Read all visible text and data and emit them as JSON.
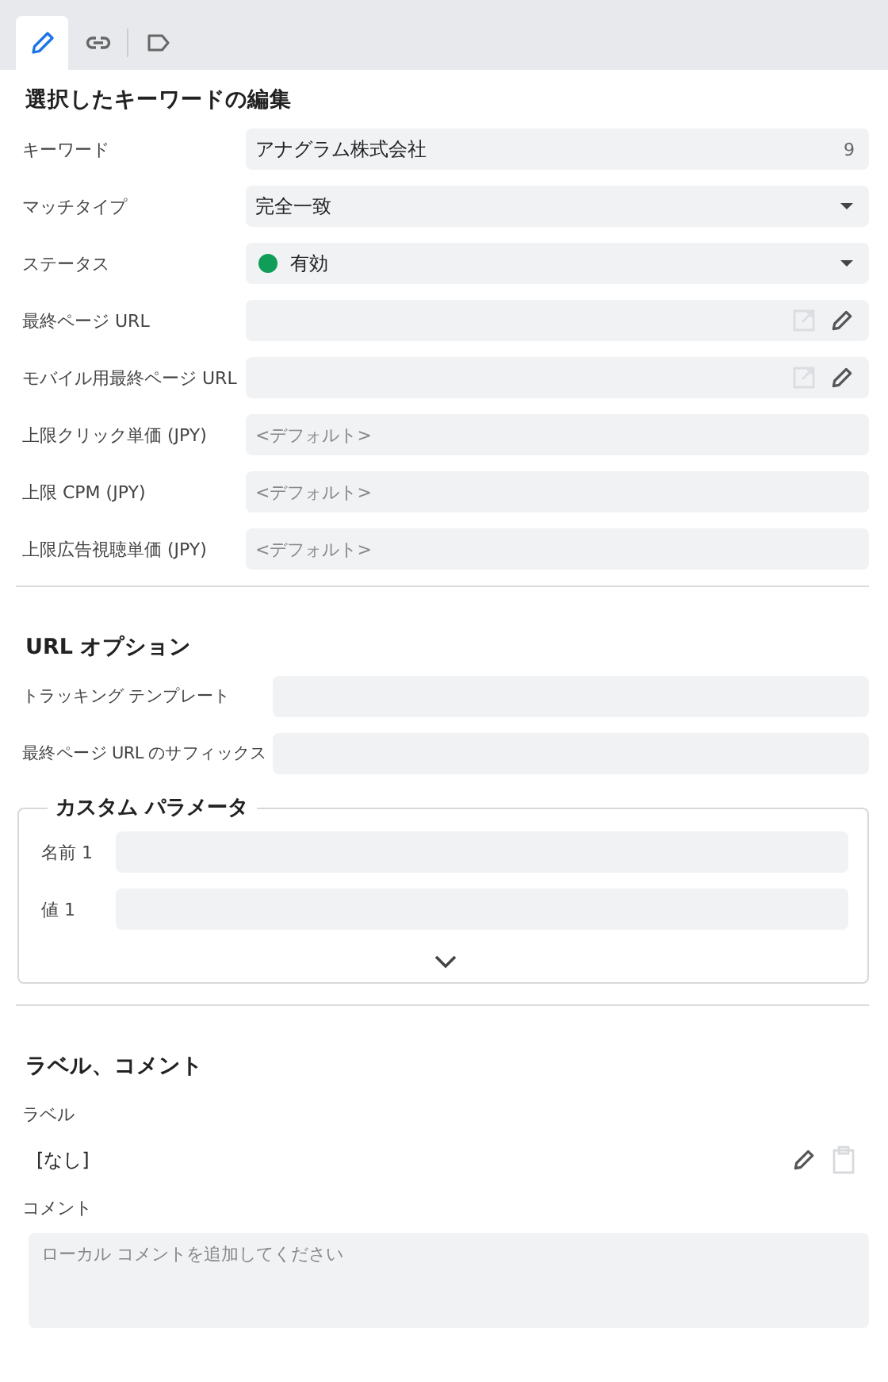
{
  "tabs": [
    {
      "kind": "pencil",
      "selected": true
    },
    {
      "kind": "link",
      "selected": false
    },
    {
      "kind": "label",
      "selected": false
    }
  ],
  "edit_section": {
    "title": "選択したキーワードの編集",
    "fields": [
      {
        "label": "キーワード",
        "kind": "text",
        "value": "アナグラム株式会社",
        "count": "9"
      },
      {
        "label": "マッチタイプ",
        "kind": "select",
        "value": "完全一致"
      },
      {
        "label": "ステータス",
        "kind": "status",
        "value": "有効",
        "color": "#0f9d58"
      },
      {
        "label": "最終ページ URL",
        "kind": "url"
      },
      {
        "label": "モバイル用最終ページ URL",
        "kind": "url"
      },
      {
        "label": "上限クリック単価 (JPY)",
        "kind": "text",
        "placeholder": "<デフォルト>"
      },
      {
        "label": "上限 CPM (JPY)",
        "kind": "text",
        "placeholder": "<デフォルト>"
      },
      {
        "label": "上限広告視聴単価 (JPY)",
        "kind": "text",
        "placeholder": "<デフォルト>"
      }
    ]
  },
  "url_options": {
    "title": "URL オプション",
    "fields": [
      {
        "label": "トラッキング テンプレート"
      },
      {
        "label": "最終ページ URL のサフィックス"
      }
    ],
    "custom_parameters": {
      "title": "カスタム パラメータ",
      "fields": [
        {
          "label": "名前 1"
        },
        {
          "label": "値 1"
        }
      ]
    }
  },
  "labels_comments": {
    "title": "ラベル、コメント",
    "label_heading": "ラベル",
    "label_value": "[なし]",
    "comment_heading": "コメント",
    "comment_placeholder": "ローカル コメントを追加してください"
  }
}
